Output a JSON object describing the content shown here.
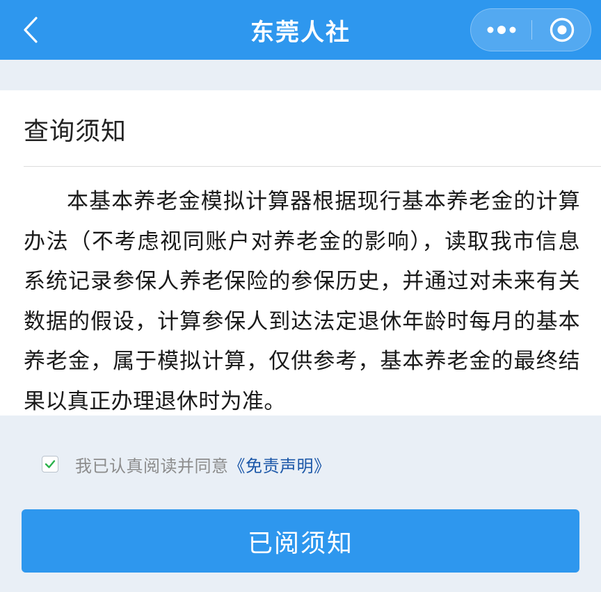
{
  "header": {
    "title": "东莞人社",
    "back_icon": "chevron-left-icon",
    "more_icon": "more-dots-icon",
    "close_icon": "target-circle-icon"
  },
  "notice": {
    "title": "查询须知",
    "body": "本基本养老金模拟计算器根据现行基本养老金的计算办法（不考虑视同账户对养老金的影响），读取我市信息系统记录参保人养老保险的参保历史，并通过对未来有关数据的假设，计算参保人到达法定退休年龄时每月的基本养老金，属于模拟计算，仅供参考，基本养老金的最终结果以真正办理退休时为准。"
  },
  "agreement": {
    "checked": true,
    "text": "我已认真阅读并同意",
    "link": "《免责声明》"
  },
  "confirm_button": {
    "label": "已阅须知"
  },
  "colors": {
    "brand_blue": "#2e97ee",
    "page_background": "#e9eff6",
    "link_blue": "#1b57a8",
    "check_green": "#2bb24c"
  }
}
